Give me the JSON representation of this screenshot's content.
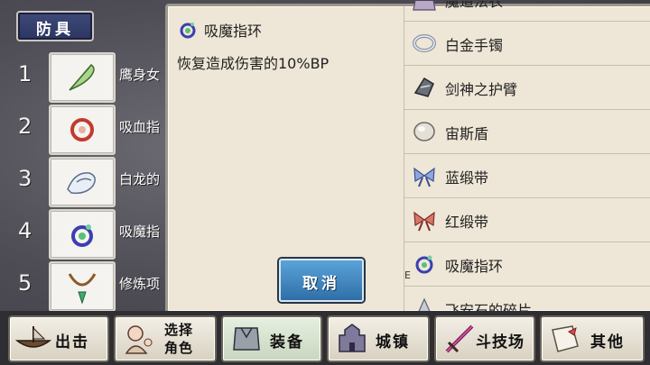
{
  "header": {
    "title": "防具"
  },
  "left_list": [
    {
      "num": "1",
      "name": "鹰身女",
      "icon": "feather-icon"
    },
    {
      "num": "2",
      "name": "吸血指",
      "icon": "red-ring-icon"
    },
    {
      "num": "3",
      "name": "白龙的",
      "icon": "white-dragon-icon"
    },
    {
      "num": "4",
      "name": "吸魔指",
      "icon": "magic-ring-icon"
    },
    {
      "num": "5",
      "name": "修炼项",
      "icon": "necklace-icon"
    }
  ],
  "detail": {
    "title": "吸魔指环",
    "description": "恢复造成伤害的10%BP",
    "cancel_label": "取消",
    "stray_text": "E"
  },
  "right_list": [
    {
      "name": "魔道法衣",
      "icon": "robe-icon"
    },
    {
      "name": "白金手镯",
      "icon": "bracelet-icon"
    },
    {
      "name": "剑神之护臂",
      "icon": "gauntlet-icon"
    },
    {
      "name": "宙斯盾",
      "icon": "shield-icon"
    },
    {
      "name": "蓝缎带",
      "icon": "blue-ribbon-icon"
    },
    {
      "name": "红缎带",
      "icon": "red-ribbon-icon"
    },
    {
      "name": "吸魔指环",
      "icon": "magic-ring-icon"
    },
    {
      "name": "飞安石的碎片",
      "icon": "stone-shard-icon"
    }
  ],
  "nav": {
    "sortie": "出击",
    "select_line1": "选择",
    "select_line2": "角色",
    "equip": "装备",
    "town": "城镇",
    "arena": "斗技场",
    "other": "其他"
  },
  "colors": {
    "panel": "#eee6d6",
    "header": "#2c3560",
    "cancel": "#3f86c0"
  }
}
